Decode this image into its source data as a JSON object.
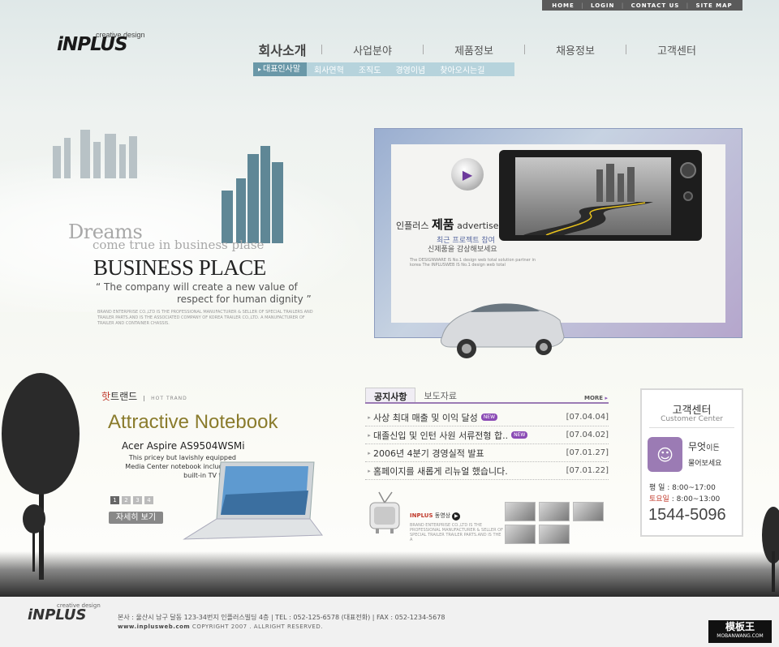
{
  "topbar": {
    "home": "HOME",
    "login": "LOGIN",
    "contact": "CONTACT US",
    "sitemap": "SITE MAP"
  },
  "logo": {
    "mark": "iNPLUS",
    "tagline": "creative design"
  },
  "nav": {
    "items": [
      "회사소개",
      "사업분야",
      "제품정보",
      "채용정보",
      "고객센터"
    ],
    "sub": [
      "대표인사말",
      "회사연혁",
      "조직도",
      "경영이념",
      "찾아오시는길"
    ]
  },
  "hero": {
    "dreams": "Dreams",
    "come_true": "come true in  business plase",
    "title": "BUSINESS PLACE",
    "quote1": "“ The company will create a new value of",
    "quote2": "respect for human dignity ”",
    "small": "BRAND ENTERPRISE CO.,LTD IS THE PROFESSIONAL MANUFACTURER & SELLER OF SPECIAL TRAILERS AND TRAILER PARTS.AND IS THE ASSOCIATED COMPANY OF KOREA TRAILER CO.,LTD. A MANUFACTURER OF TRAILER AND CONTAINER CHASSIS."
  },
  "product": {
    "brand": "인플러스",
    "product": "제품",
    "advertise": "advertise",
    "sub1": "최근 프로젝트 참여",
    "sub2": "신제품을 감상해보세요",
    "small": "The DESIGNWARE IS No.1 design web total solution partner in korea The INPLUSWEB IS No.1 design web total"
  },
  "hot": {
    "hot": "핫",
    "trend": "트랜드",
    "sub": "HOT TRAND",
    "title": "Attractive Notebook",
    "model": "Acer Aspire AS9504WSMi",
    "desc": "This pricey but lavishly equipped Media Center notebook includes a built-in TV tuner",
    "pages": [
      "1",
      "2",
      "3",
      "4"
    ],
    "detail": "자세히 보기"
  },
  "board": {
    "tabs": [
      "공지사항",
      "보도자료"
    ],
    "more": "MORE",
    "rows": [
      {
        "title": "사상 최대 매출 및 이익 달성",
        "new": "NEW",
        "date": "[07.04.04]"
      },
      {
        "title": "대졸신입 및 인턴 사원 서류전형 합..",
        "new": "NEW",
        "date": "[07.04.02]"
      },
      {
        "title": "2006년 4분기 경영실적 발표",
        "new": "",
        "date": "[07.01.27]"
      },
      {
        "title": "홈페이지를 새롭게 리뉴얼 했습니다.",
        "new": "",
        "date": "[07.01.22]"
      }
    ],
    "tv_brand": "INPLUS",
    "tv_label": "동영상",
    "tv_small": "BRAND ENTERPRISE CO.,LTD IS THE PROFESSIONAL MANUFACTURER & SELLER OF SPECIAL TRAILER TRAILER PARTS.AND IS THE A"
  },
  "cc": {
    "title": "고객센터",
    "sub": "Customer Center",
    "q1": "무엇",
    "q1b": "이든",
    "q2": "물어보세요",
    "weekday": "평  일 : 8:00~17:00",
    "saturday_label": "토요일",
    "saturday": " : 8:00~13:00",
    "phone": "1544-5096"
  },
  "footer": {
    "logo": "iNPLUS",
    "tagline": "creative design",
    "address": "본사 : 울산시 남구 달동 123-34번지 인플러스빌딩 4층    |   TEL : 052-125-6578 (대표전화)   |   FAX : 052-1234-5678",
    "url": "www.inplusweb.com",
    "copyright": " COPYRIGHT 2007 . ALLRIGHT RESERVED."
  },
  "watermark": {
    "title": "模板王",
    "url": "MOBANWANG.COM"
  }
}
